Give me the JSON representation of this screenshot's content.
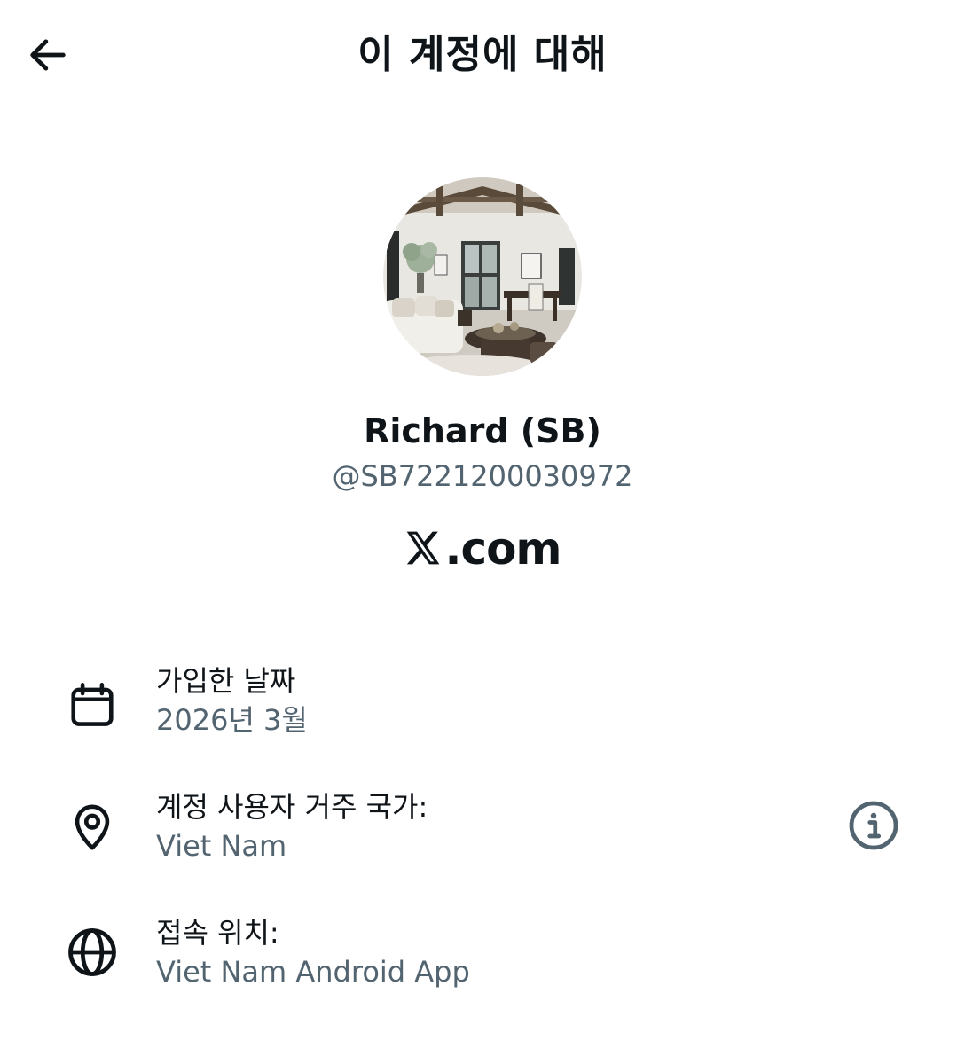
{
  "header": {
    "title": "이 계정에 대해",
    "back_icon": "arrow-left-icon"
  },
  "profile": {
    "avatar_description": "living-room-photo",
    "display_name": "Richard (SB)",
    "handle": "@SB7221200030972",
    "brand_suffix": ".com"
  },
  "info": {
    "joined": {
      "icon": "calendar-icon",
      "label": "가입한 날짜",
      "value": "2026년 3월"
    },
    "country": {
      "icon": "location-pin-icon",
      "label": "계정 사용자 거주 국가:",
      "value": "Viet Nam",
      "action_icon": "info-icon"
    },
    "connected": {
      "icon": "globe-icon",
      "label": "접속 위치:",
      "value": "Viet Nam Android App"
    }
  },
  "colors": {
    "primary_text": "#0f1419",
    "secondary_text": "#536471",
    "background": "#ffffff"
  }
}
